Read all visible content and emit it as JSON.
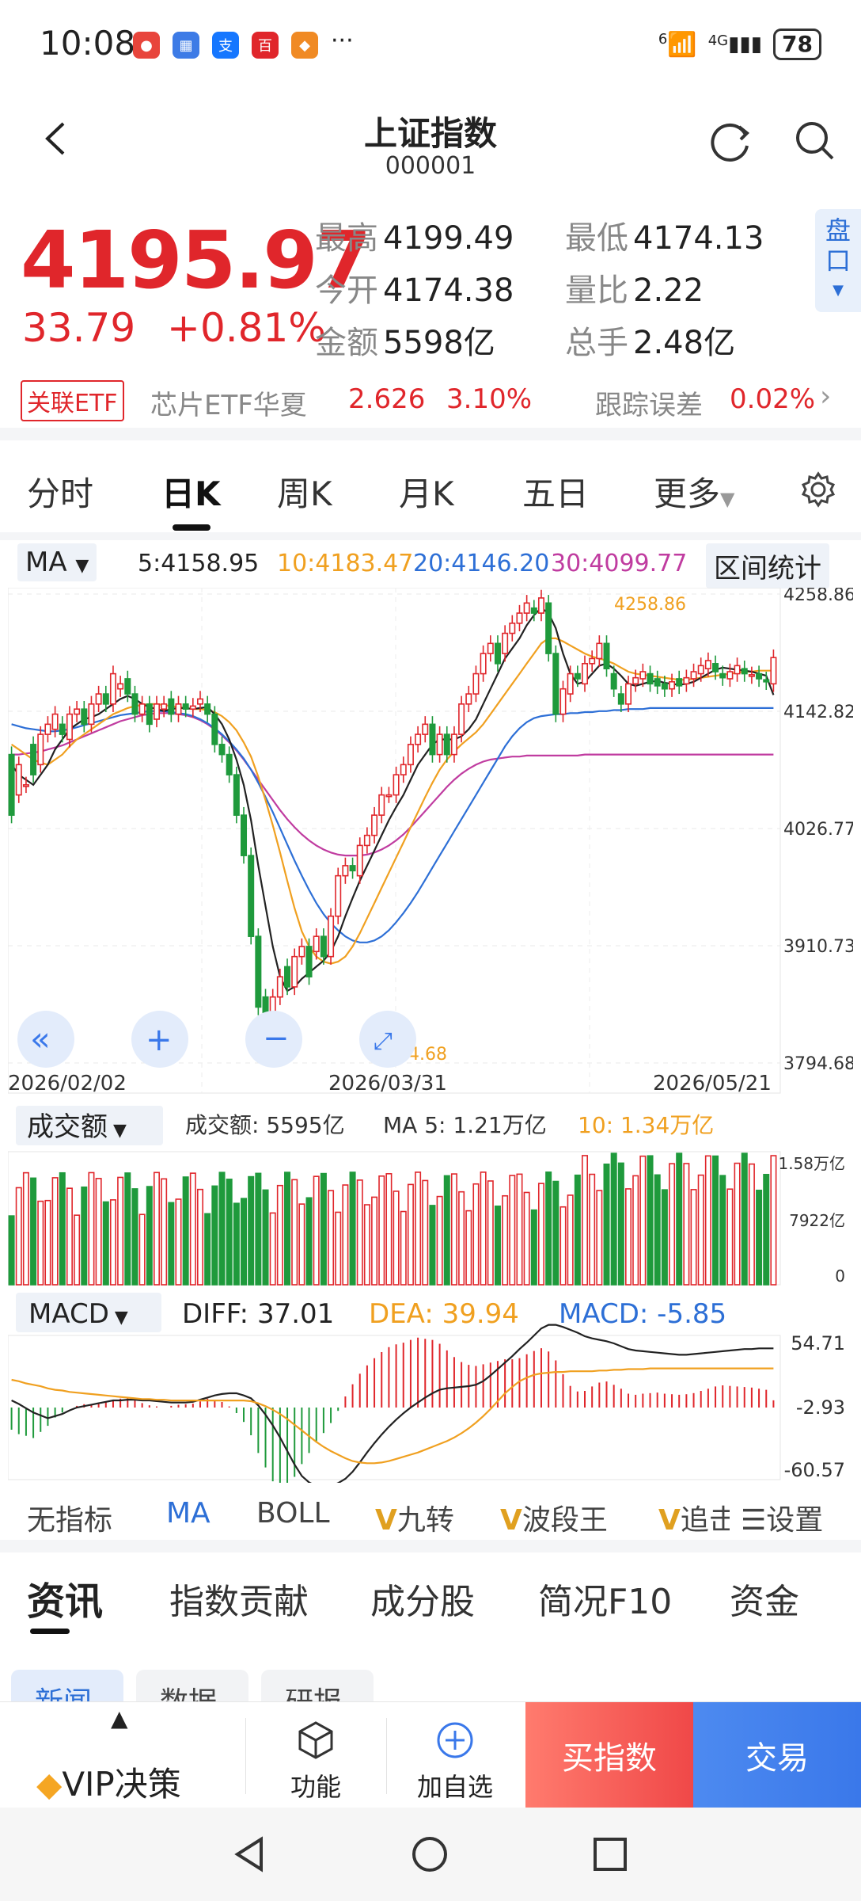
{
  "status_bar": {
    "time": "10:08",
    "signal_label": "4G",
    "wifi_label": "6",
    "battery": "78"
  },
  "header": {
    "title": "上证指数",
    "code": "000001"
  },
  "quote": {
    "price": "4195.97",
    "change": "33.79",
    "change_pct": "+0.81%",
    "stats": [
      {
        "k": "最高",
        "v": "4199.49"
      },
      {
        "k": "最低",
        "v": "4174.13"
      },
      {
        "k": "今开",
        "v": "4174.38"
      },
      {
        "k": "量比",
        "v": "2.22"
      },
      {
        "k": "金额",
        "v": "5598亿"
      },
      {
        "k": "总手",
        "v": "2.48亿"
      }
    ],
    "pankou": "盘口"
  },
  "etf": {
    "tag": "关联ETF",
    "name": "芯片ETF华夏",
    "price": "2.626",
    "pct": "3.10%",
    "track_label": "跟踪误差",
    "track_value": "0.02%"
  },
  "period_tabs": [
    "分时",
    "日K",
    "周K",
    "月K",
    "五日",
    "更多"
  ],
  "ma_legend": {
    "selector": "MA",
    "ma5": "5:4158.95",
    "ma10": "10:4183.47",
    "ma20": "20:4146.20",
    "ma30": "30:4099.77",
    "range_stats": "区间统计"
  },
  "colors": {
    "up": "#e0262b",
    "down": "#1f9a3c",
    "ma5": "#222222",
    "ma10": "#f0a020",
    "ma20": "#2d6fd6",
    "ma30": "#c03ca0"
  },
  "chart_data": [
    {
      "type": "candlestick",
      "title": "",
      "y_ticks": [
        "4258.86",
        "4142.82",
        "4026.77",
        "3910.73",
        "3794.68"
      ],
      "x_ticks": [
        "2026/02/02",
        "2026/03/31",
        "2026/05/21"
      ],
      "ylim": [
        3794.68,
        4258.86
      ],
      "annotations": {
        "high": "4258.86",
        "low": "3794.68"
      },
      "x": [
        0,
        1,
        2,
        3,
        4,
        5,
        6,
        7,
        8,
        9,
        10,
        11,
        12,
        13,
        14,
        15,
        16,
        17,
        18,
        19,
        20,
        21,
        22,
        23,
        24,
        25,
        26,
        27,
        28,
        29,
        30,
        31,
        32,
        33,
        34,
        35,
        36,
        37,
        38,
        39,
        40,
        41,
        42,
        43,
        44,
        45,
        46,
        47,
        48,
        49,
        50,
        51,
        52,
        53,
        54,
        55,
        56,
        57,
        58,
        59,
        60,
        61,
        62,
        63,
        64,
        65,
        66,
        67,
        68,
        69,
        70,
        71,
        72,
        73,
        74,
        75,
        76,
        77,
        78,
        79,
        80,
        81,
        82,
        83,
        84,
        85,
        86,
        87,
        88,
        89,
        90,
        91,
        92,
        93,
        94,
        95,
        96,
        97,
        98,
        99,
        100,
        101,
        102,
        103,
        104,
        105
      ],
      "open": [
        4100,
        4060,
        4070,
        4110,
        4090,
        4120,
        4125,
        4130,
        4115,
        4140,
        4145,
        4130,
        4150,
        4160,
        4150,
        4165,
        4175,
        4160,
        4140,
        4150,
        4135,
        4145,
        4155,
        4140,
        4150,
        4145,
        4150,
        4150,
        4140,
        4110,
        4100,
        4080,
        4040,
        4000,
        3920,
        3860,
        3830,
        3860,
        3890,
        3870,
        3900,
        3910,
        3905,
        3920,
        3900,
        3940,
        3980,
        3990,
        3980,
        4010,
        4020,
        4040,
        4060,
        4060,
        4080,
        4090,
        4110,
        4120,
        4130,
        4100,
        4120,
        4100,
        4120,
        4150,
        4160,
        4180,
        4200,
        4210,
        4200,
        4220,
        4230,
        4240,
        4245,
        4240,
        4250,
        4200,
        4140,
        4160,
        4180,
        4170,
        4190,
        4195,
        4210,
        4180,
        4160,
        4150,
        4170,
        4175,
        4180,
        4175,
        4170,
        4165,
        4175,
        4170,
        4175,
        4180,
        4185,
        4190,
        4180,
        4175,
        4180,
        4185,
        4178,
        4180,
        4174,
        4170
      ],
      "close": [
        4040,
        4090,
        4070,
        4080,
        4120,
        4130,
        4140,
        4120,
        4140,
        4145,
        4130,
        4150,
        4160,
        4150,
        4180,
        4170,
        4160,
        4140,
        4150,
        4130,
        4150,
        4150,
        4140,
        4150,
        4145,
        4148,
        4155,
        4140,
        4110,
        4100,
        4080,
        4040,
        4000,
        3920,
        3850,
        3830,
        3860,
        3880,
        3870,
        3900,
        3910,
        3880,
        3920,
        3900,
        3940,
        3980,
        3990,
        3985,
        4010,
        4020,
        4040,
        4060,
        4060,
        4080,
        4090,
        4110,
        4120,
        4130,
        4100,
        4120,
        4100,
        4120,
        4150,
        4160,
        4180,
        4200,
        4210,
        4190,
        4220,
        4230,
        4240,
        4250,
        4240,
        4255,
        4200,
        4140,
        4165,
        4180,
        4175,
        4190,
        4195,
        4210,
        4185,
        4165,
        4150,
        4170,
        4176,
        4182,
        4170,
        4168,
        4165,
        4172,
        4168,
        4176,
        4182,
        4188,
        4193,
        4182,
        4176,
        4182,
        4188,
        4180,
        4179,
        4175,
        4172,
        4196
      ],
      "ma5": [
        4090,
        4080,
        4075,
        4070,
        4080,
        4090,
        4105,
        4115,
        4125,
        4130,
        4135,
        4137,
        4140,
        4145,
        4150,
        4155,
        4158,
        4155,
        4150,
        4147,
        4145,
        4143,
        4145,
        4146,
        4146,
        4145,
        4146,
        4147,
        4140,
        4130,
        4115,
        4095,
        4070,
        4035,
        3990,
        3950,
        3910,
        3880,
        3866,
        3870,
        3878,
        3884,
        3890,
        3896,
        3905,
        3920,
        3940,
        3958,
        3975,
        3990,
        4005,
        4020,
        4035,
        4048,
        4060,
        4075,
        4090,
        4100,
        4110,
        4115,
        4115,
        4115,
        4118,
        4125,
        4135,
        4150,
        4165,
        4180,
        4195,
        4205,
        4215,
        4228,
        4238,
        4245,
        4240,
        4225,
        4200,
        4180,
        4170,
        4172,
        4180,
        4188,
        4190,
        4185,
        4178,
        4170,
        4168,
        4170,
        4172,
        4173,
        4171,
        4170,
        4169,
        4170,
        4172,
        4176,
        4180,
        4184,
        4186,
        4185,
        4184,
        4183,
        4182,
        4180,
        4178,
        4159
      ],
      "ma10": [
        4110,
        4105,
        4100,
        4095,
        4092,
        4090,
        4095,
        4100,
        4108,
        4115,
        4120,
        4125,
        4130,
        4135,
        4140,
        4143,
        4146,
        4148,
        4149,
        4150,
        4150,
        4149,
        4148,
        4147,
        4146,
        4145,
        4145,
        4144,
        4142,
        4138,
        4132,
        4124,
        4112,
        4098,
        4078,
        4055,
        4030,
        4003,
        3975,
        3948,
        3925,
        3910,
        3900,
        3895,
        3893,
        3895,
        3900,
        3910,
        3923,
        3938,
        3953,
        3968,
        3983,
        3998,
        4013,
        4028,
        4043,
        4058,
        4072,
        4085,
        4095,
        4103,
        4110,
        4116,
        4122,
        4130,
        4140,
        4150,
        4160,
        4170,
        4180,
        4190,
        4200,
        4210,
        4215,
        4215,
        4212,
        4208,
        4204,
        4200,
        4197,
        4195,
        4193,
        4190,
        4186,
        4182,
        4180,
        4179,
        4178,
        4177,
        4176,
        4175,
        4174,
        4174,
        4175,
        4176,
        4177,
        4178,
        4179,
        4180,
        4181,
        4182,
        4182,
        4183,
        4183,
        4183
      ],
      "ma20": [
        4130,
        4128,
        4126,
        4125,
        4124,
        4123,
        4123,
        4124,
        4125,
        4127,
        4129,
        4131,
        4133,
        4135,
        4137,
        4139,
        4140,
        4141,
        4142,
        4143,
        4143,
        4143,
        4142,
        4141,
        4140,
        4138,
        4135,
        4131,
        4126,
        4120,
        4113,
        4105,
        4096,
        4085,
        4072,
        4058,
        4043,
        4027,
        4011,
        3995,
        3980,
        3966,
        3953,
        3942,
        3933,
        3926,
        3920,
        3916,
        3914,
        3914,
        3916,
        3920,
        3926,
        3934,
        3943,
        3953,
        3964,
        3976,
        3988,
        4000,
        4012,
        4024,
        4036,
        4048,
        4060,
        4072,
        4084,
        4096,
        4108,
        4118,
        4126,
        4132,
        4136,
        4138,
        4139,
        4140,
        4140,
        4141,
        4141,
        4142,
        4142,
        4143,
        4143,
        4144,
        4144,
        4145,
        4145,
        4145,
        4146,
        4146,
        4146,
        4146,
        4146,
        4146,
        4146,
        4146,
        4146,
        4146,
        4146,
        4146,
        4146,
        4146,
        4146,
        4146,
        4146,
        4146
      ],
      "ma30": [
        4100,
        4100,
        4101,
        4102,
        4103,
        4105,
        4107,
        4109,
        4112,
        4115,
        4118,
        4121,
        4124,
        4127,
        4130,
        4133,
        4135,
        4137,
        4139,
        4140,
        4141,
        4141,
        4141,
        4140,
        4139,
        4137,
        4134,
        4130,
        4125,
        4119,
        4112,
        4104,
        4095,
        4085,
        4075,
        4065,
        4055,
        4045,
        4036,
        4028,
        4021,
        4015,
        4010,
        4006,
        4003,
        4001,
        4000,
        4000,
        4000,
        4001,
        4003,
        4006,
        4010,
        4015,
        4021,
        4028,
        4036,
        4044,
        4052,
        4060,
        4068,
        4075,
        4081,
        4086,
        4090,
        4093,
        4095,
        4096,
        4097,
        4098,
        4098,
        4099,
        4099,
        4099,
        4099,
        4099,
        4099,
        4099,
        4099,
        4100,
        4100,
        4100,
        4100,
        4100,
        4100,
        4100,
        4100,
        4100,
        4100,
        4100,
        4100,
        4100,
        4100,
        4100,
        4100,
        4100,
        4100,
        4100,
        4100,
        4100,
        4100,
        4100,
        4100,
        4100,
        4100,
        4100
      ]
    },
    {
      "type": "bar",
      "title": "",
      "selector": "成交额",
      "legend": {
        "amount": "成交额:  5595亿",
        "ma5": "MA 5: 1.21万亿",
        "ma10": "10: 1.34万亿"
      },
      "y_ticks": [
        "1.58万亿",
        "7922亿",
        "0"
      ]
    },
    {
      "type": "bar",
      "title": "",
      "selector": "MACD",
      "legend": {
        "diff": "DIFF: 37.01",
        "dea": "DEA: 39.94",
        "macd": "MACD: -5.85"
      },
      "y_ticks": [
        "54.71",
        "-2.93",
        "-60.57"
      ]
    }
  ],
  "indicators": {
    "items": [
      "无指标",
      "MA",
      "BOLL",
      "九转",
      "波段王",
      "追击"
    ],
    "settings": "设置",
    "active": "MA"
  },
  "bottom_tabs": [
    "资讯",
    "指数贡献",
    "成分股",
    "简况F10",
    "资金"
  ],
  "sub_tabs": [
    "新闻",
    "数据",
    "研报"
  ],
  "action_bar": {
    "vip": "VIP决策",
    "func": "功能",
    "add": "加自选",
    "buy": "买指数",
    "trade": "交易"
  }
}
